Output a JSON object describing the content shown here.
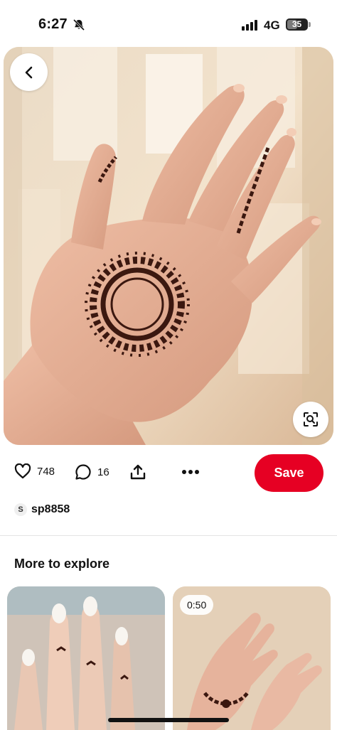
{
  "status_bar": {
    "time": "6:27",
    "network": "4G",
    "battery": "35",
    "icons": [
      "bell-slash-icon",
      "signal-bars-icon",
      "battery-icon"
    ]
  },
  "pin": {
    "image_alt": "Hand with henna mandala design on palm",
    "likes": "748",
    "comments": "16",
    "save_label": "Save",
    "creator_initial": "S",
    "creator_name": "sp8858"
  },
  "explore": {
    "title": "More to explore",
    "items": [
      {
        "duration": ""
      },
      {
        "duration": "0:50"
      }
    ]
  },
  "colors": {
    "save": "#e60023",
    "henna": "#3b1810",
    "skin": "#e2a88c"
  }
}
